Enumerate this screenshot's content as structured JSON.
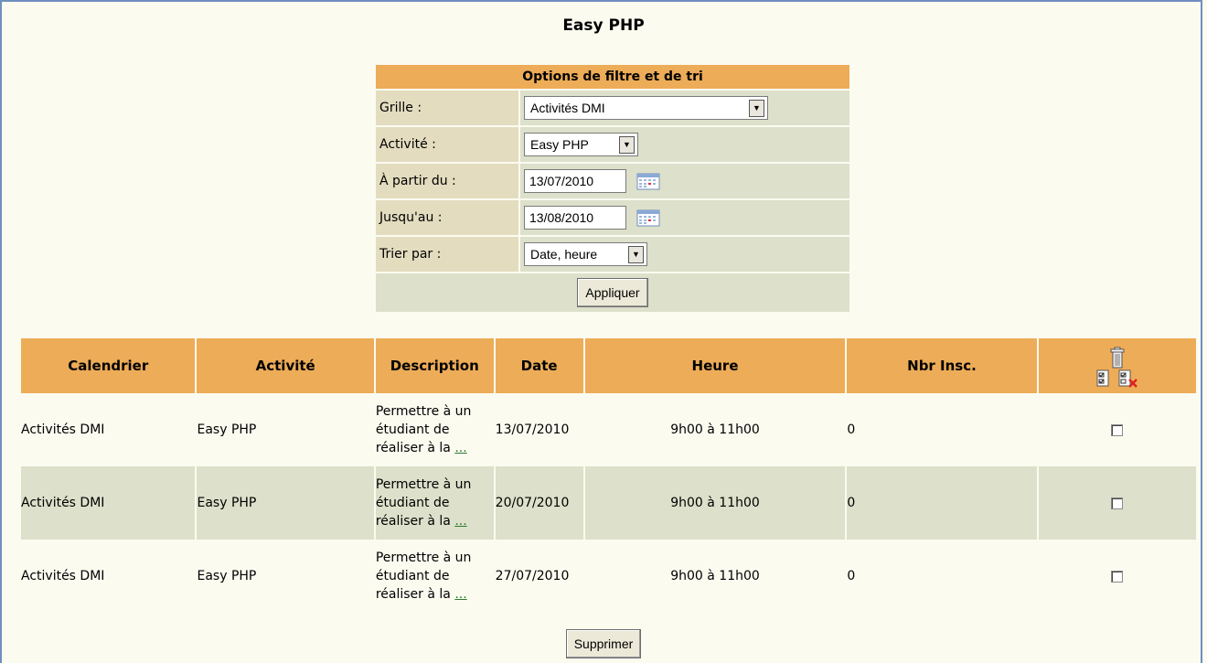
{
  "title": "Easy PHP",
  "filter": {
    "header": "Options de filtre et de tri",
    "grille_label": "Grille :",
    "grille_value": "Activités DMI",
    "activite_label": "Activité :",
    "activite_value": "Easy PHP",
    "from_label": "À partir du :",
    "from_value": "13/07/2010",
    "to_label": "Jusqu'au :",
    "to_value": "13/08/2010",
    "sort_label": "Trier par :",
    "sort_value": "Date, heure",
    "apply_label": "Appliquer"
  },
  "table": {
    "columns": [
      "Calendrier",
      "Activité",
      "Description",
      "Date",
      "Heure",
      "Nbr Insc."
    ],
    "rows": [
      {
        "calendrier": "Activités DMI",
        "activite": "Easy PHP",
        "desc1": "Permettre à un",
        "desc2": "étudiant de",
        "desc3": "réaliser à la",
        "more": "...",
        "date": "13/07/2010",
        "heure": "9h00 à 11h00",
        "nbr": "0"
      },
      {
        "calendrier": "Activités DMI",
        "activite": "Easy PHP",
        "desc1": "Permettre à un",
        "desc2": "étudiant de",
        "desc3": "réaliser à la",
        "more": "...",
        "date": "20/07/2010",
        "heure": "9h00 à 11h00",
        "nbr": "0"
      },
      {
        "calendrier": "Activités DMI",
        "activite": "Easy PHP",
        "desc1": "Permettre à un",
        "desc2": "étudiant de",
        "desc3": "réaliser à la",
        "more": "...",
        "date": "27/07/2010",
        "heure": "9h00 à 11h00",
        "nbr": "0"
      }
    ]
  },
  "delete_label": "Supprimer",
  "colors": {
    "header": "#edac57",
    "label_cell": "#e3dcbf",
    "value_cell": "#dde0ca",
    "background": "#fbfbf0",
    "link": "#2a7a2a"
  },
  "icons": [
    "calendar-icon",
    "dropdown-arrow-icon",
    "trash-icon",
    "select-all-icon",
    "deselect-all-icon"
  ]
}
